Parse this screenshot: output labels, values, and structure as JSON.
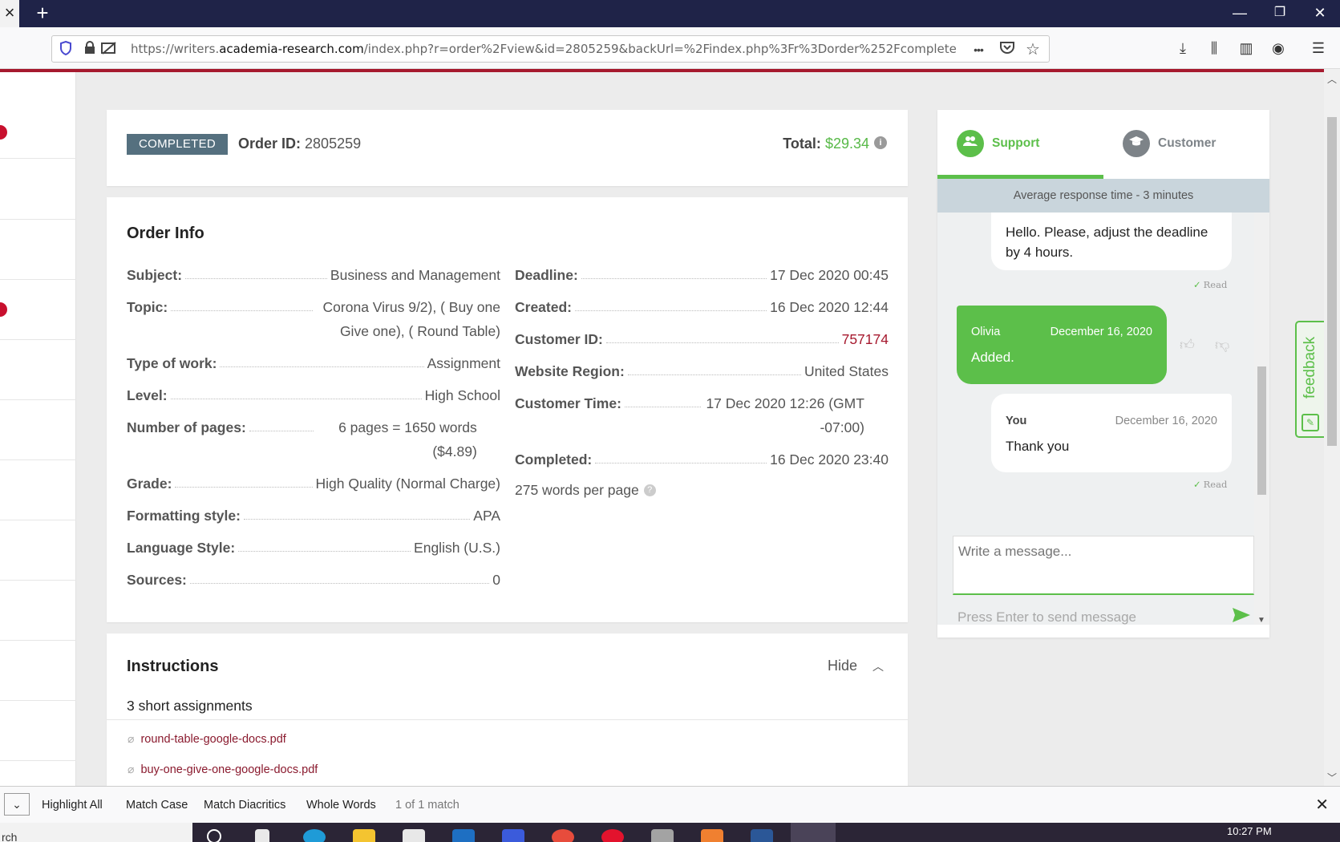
{
  "browser": {
    "url_prefix": "https://writers.",
    "url_domain": "academia-research.com",
    "url_suffix": "/index.php?r=order%2Fview&id=2805259&backUrl=%2Findex.php%3Fr%3Dorder%252Fcomplete",
    "tab_close": "×",
    "tab_new": "+",
    "minimize": "—",
    "restore": "❐",
    "close": "✕",
    "more": "•••"
  },
  "order": {
    "status": "COMPLETED",
    "id_label": "Order ID:",
    "id_value": "2805259",
    "total_label": "Total:",
    "total_value": "$29.34"
  },
  "order_info": {
    "title": "Order Info",
    "left": [
      {
        "label": "Subject:",
        "value": "Business and Management"
      },
      {
        "label": "Topic:",
        "value": "Corona Virus 9/2), ( Buy one Give one), ( Round Table)"
      },
      {
        "label": "Type of work:",
        "value": "Assignment"
      },
      {
        "label": "Level:",
        "value": "High School"
      },
      {
        "label": "Number of pages:",
        "value": "6 pages = 1650 words ($4.89)"
      },
      {
        "label": "Grade:",
        "value": "High Quality (Normal Charge)"
      },
      {
        "label": "Formatting style:",
        "value": "APA"
      },
      {
        "label": "Language Style:",
        "value": "English (U.S.)"
      },
      {
        "label": "Sources:",
        "value": "0"
      }
    ],
    "right": [
      {
        "label": "Deadline:",
        "value": "17 Dec 2020 00:45"
      },
      {
        "label": "Created:",
        "value": "16 Dec 2020 12:44"
      },
      {
        "label": "Customer ID:",
        "value": "757174"
      },
      {
        "label": "Website Region:",
        "value": "United States"
      },
      {
        "label": "Customer Time:",
        "value": "17 Dec 2020 12:26 (GMT -07:00)"
      },
      {
        "label": "Completed:",
        "value": "16 Dec 2020 23:40"
      }
    ],
    "words_per_page": "275 words per page"
  },
  "instructions": {
    "title": "Instructions",
    "hide_label": "Hide",
    "text": "3 short assignments",
    "files": [
      "round-table-google-docs.pdf",
      "buy-one-give-one-google-docs.pdf"
    ]
  },
  "chat": {
    "tab_support": "Support",
    "tab_customer": "Customer",
    "response_time": "Average response time - 3 minutes",
    "messages": [
      {
        "text": "Hello. Please, adjust the deadline by 4 hours.",
        "status": "Read"
      },
      {
        "author": "Olivia",
        "date": "December 16, 2020",
        "text": "Added."
      },
      {
        "author": "You",
        "date": "December 16, 2020",
        "text": "Thank you",
        "status": "Read"
      }
    ],
    "placeholder": "Write a message...",
    "hint": "Press Enter to send message",
    "feedback": "feedback"
  },
  "findbar": {
    "highlight_all": "Highlight All",
    "match_case": "Match Case",
    "match_diacritics": "Match Diacritics",
    "whole_words": "Whole Words",
    "result": "1 of 1 match"
  },
  "taskbar": {
    "search": "rch",
    "time": "10:27 PM"
  },
  "colors": {
    "accent_green": "#5cbf4a",
    "brand_red": "#a6192e",
    "status_badge": "#55707f",
    "browser_bar": "#1f2348"
  }
}
